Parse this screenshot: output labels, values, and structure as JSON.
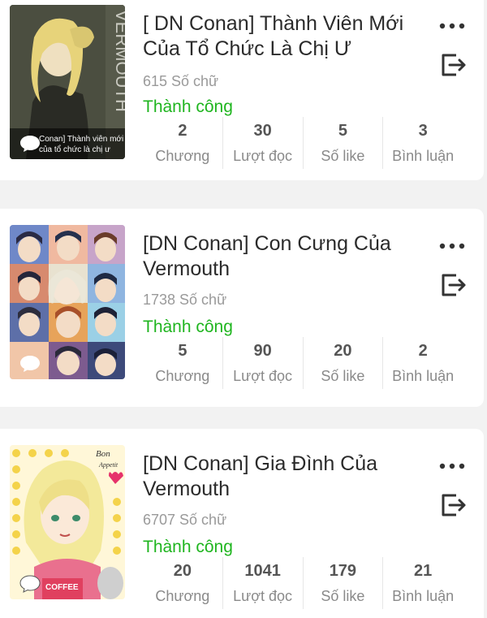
{
  "stories": [
    {
      "title": "[ DN Conan] Thành Viên Mới Của Tổ Chức Là Chị Ư",
      "words": "615 Số chữ",
      "status": "Thành công",
      "cover_caption_1": "Conan] Thành viên mới",
      "cover_caption_2": "của tổ chức là chị ư",
      "cover_vertical_text": "VERMOUTH",
      "stats": [
        {
          "value": "2",
          "label": "Chương"
        },
        {
          "value": "30",
          "label": "Lượt đọc"
        },
        {
          "value": "5",
          "label": "Số like"
        },
        {
          "value": "3",
          "label": "Bình luận"
        }
      ]
    },
    {
      "title": "[DN Conan] Con Cưng Của Vermouth",
      "words": "1738 Số chữ",
      "status": "Thành công",
      "stats": [
        {
          "value": "5",
          "label": "Chương"
        },
        {
          "value": "90",
          "label": "Lượt đọc"
        },
        {
          "value": "20",
          "label": "Số like"
        },
        {
          "value": "2",
          "label": "Bình luận"
        }
      ]
    },
    {
      "title": "[DN Conan] Gia Đình Của Vermouth",
      "words": "6707 Số chữ",
      "status": "Thành công",
      "cover_text_1": "Bon",
      "cover_text_2": "Appetit",
      "cover_text_3": "COFFEE",
      "stats": [
        {
          "value": "20",
          "label": "Chương"
        },
        {
          "value": "1041",
          "label": "Lượt đọc"
        },
        {
          "value": "179",
          "label": "Số like"
        },
        {
          "value": "21",
          "label": "Bình luận"
        }
      ]
    }
  ],
  "colors": {
    "status_green": "#1fb51f",
    "title_text": "#2b2b2b",
    "muted_text": "#9a9a9a",
    "background": "#f2f2f2"
  },
  "icons": [
    "more-options-icon",
    "export-icon",
    "comment-bubble-icon"
  ]
}
